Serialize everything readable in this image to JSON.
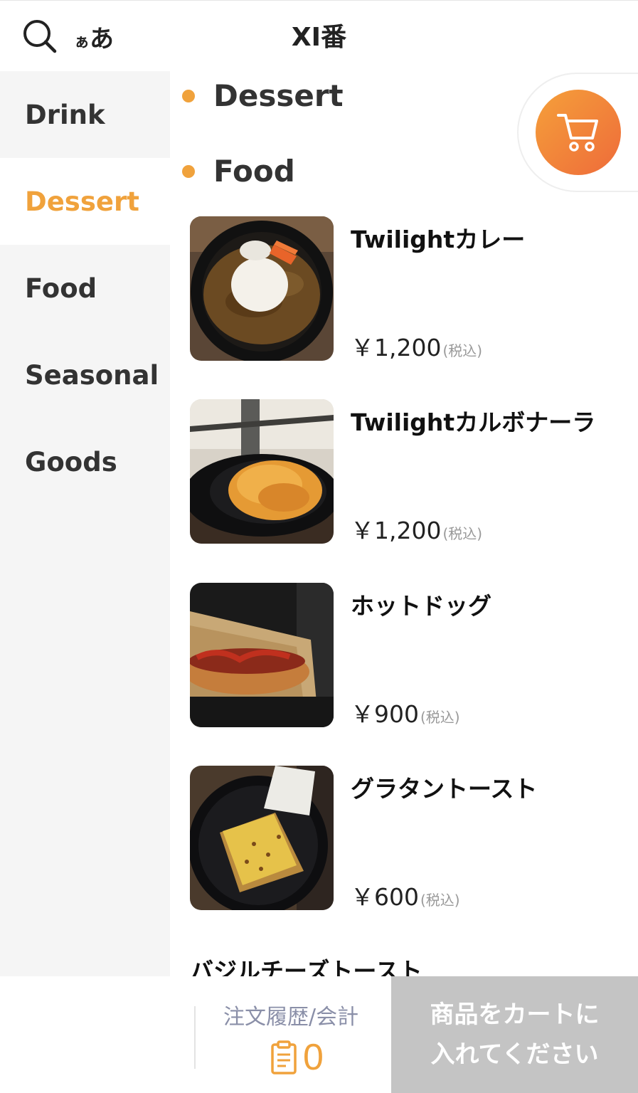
{
  "header": {
    "title": "XI番",
    "font_toggle_small": "ぁ",
    "font_toggle_large": "あ"
  },
  "sidebar": {
    "items": [
      {
        "label": "Drink",
        "active": false
      },
      {
        "label": "Dessert",
        "active": true
      },
      {
        "label": "Food",
        "active": false
      },
      {
        "label": "Seasonal",
        "active": false
      },
      {
        "label": "Goods",
        "active": false
      }
    ]
  },
  "main": {
    "categories": [
      {
        "label": "Dessert"
      },
      {
        "label": "Food"
      }
    ],
    "items": [
      {
        "name": "Twilightカレー",
        "price": "￥1,200",
        "tax": "(税込)"
      },
      {
        "name": "Twilightカルボナーラ",
        "price": "￥1,200",
        "tax": "(税込)"
      },
      {
        "name": "ホットドッグ",
        "price": "￥900",
        "tax": "(税込)"
      },
      {
        "name": "グラタントースト",
        "price": "￥600",
        "tax": "(税込)"
      }
    ],
    "partial_item_name": "バジルチーズトースト"
  },
  "footer": {
    "history_label": "注文履歴/会計",
    "history_count": "0",
    "add_to_cart_label": "商品をカートに\n入れてください"
  },
  "colors": {
    "accent": "#f0a23c",
    "cart_gradient_start": "#f5a03a",
    "cart_gradient_end": "#ee6b3a",
    "disabled_button": "#c4c4c4"
  },
  "icons": {
    "search": "search-icon",
    "cart": "cart-icon",
    "clipboard": "clipboard-icon"
  }
}
